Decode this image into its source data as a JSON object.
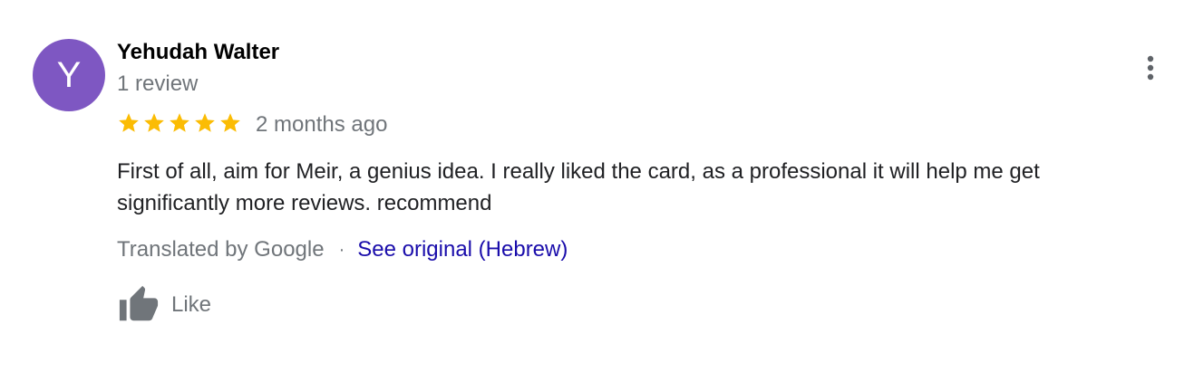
{
  "review": {
    "author": {
      "avatar_letter": "Y",
      "avatar_color": "#7e57c2",
      "name": "Yehudah Walter",
      "review_count_text": "1 review"
    },
    "rating": 5,
    "star_color": "#fbbc04",
    "time_ago": "2 months ago",
    "text": "First of all, aim for Meir, a genius idea. I really liked the card, as a professional it will help me get significantly more reviews. recommend",
    "translation": {
      "translated_by": "Translated by Google",
      "separator": "·",
      "see_original_label": "See original (Hebrew)",
      "link_color": "#1a0dab"
    },
    "like_label": "Like",
    "icons": {
      "like": "thumbs-up-icon",
      "more": "more-vert-icon",
      "star": "star-icon"
    }
  }
}
